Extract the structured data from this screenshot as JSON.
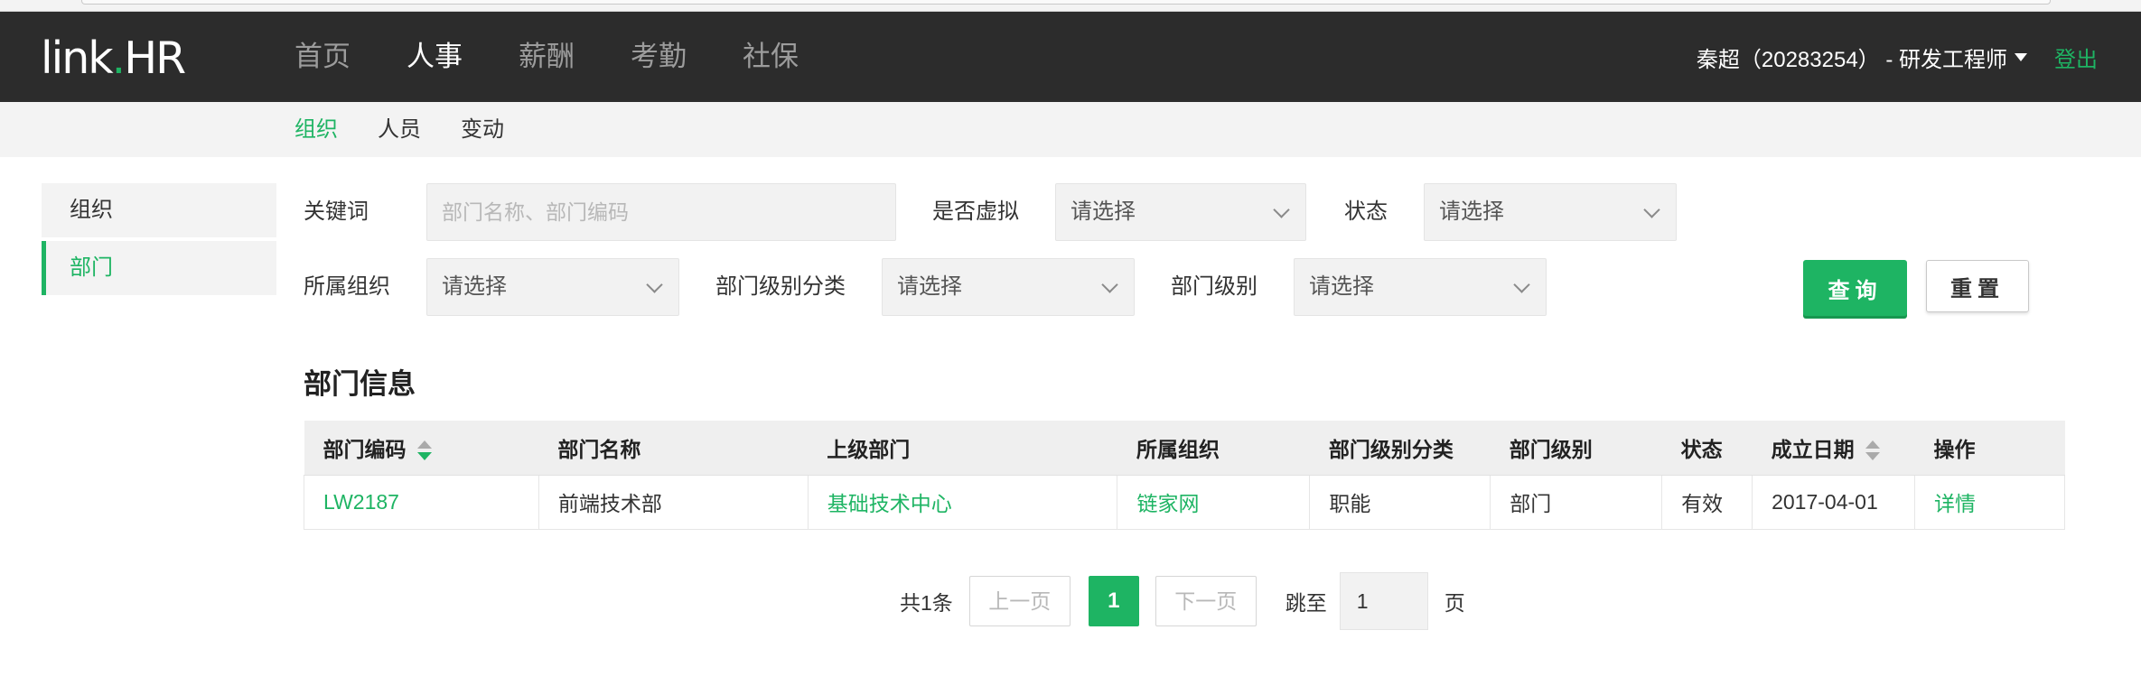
{
  "app": {
    "logo_left": "link",
    "logo_dot": ".",
    "logo_right": "HR"
  },
  "nav": {
    "items": [
      {
        "label": "首页"
      },
      {
        "label": "人事"
      },
      {
        "label": "薪酬"
      },
      {
        "label": "考勤"
      },
      {
        "label": "社保"
      }
    ],
    "active": "人事"
  },
  "user": {
    "display": "秦超（20283254） - 研发工程师",
    "logout_label": "登出"
  },
  "subnav": {
    "items": [
      {
        "label": "组织"
      },
      {
        "label": "人员"
      },
      {
        "label": "变动"
      }
    ],
    "active": "组织"
  },
  "sidebar": {
    "items": [
      {
        "label": "组织"
      },
      {
        "label": "部门"
      }
    ],
    "active": "部门"
  },
  "filters": {
    "keyword_label": "关键词",
    "keyword_placeholder": "部门名称、部门编码",
    "keyword_value": "",
    "virtual_label": "是否虚拟",
    "virtual_value": "请选择",
    "status_label": "状态",
    "status_value": "请选择",
    "org_label": "所属组织",
    "org_value": "请选择",
    "level_category_label": "部门级别分类",
    "level_category_value": "请选择",
    "level_label": "部门级别",
    "level_value": "请选择",
    "query_label": "查询",
    "reset_label": "重置"
  },
  "table": {
    "title": "部门信息",
    "columns": [
      {
        "label": "部门编码",
        "sortable": true
      },
      {
        "label": "部门名称",
        "sortable": false
      },
      {
        "label": "上级部门",
        "sortable": false
      },
      {
        "label": "所属组织",
        "sortable": false
      },
      {
        "label": "部门级别分类",
        "sortable": false
      },
      {
        "label": "部门级别",
        "sortable": false
      },
      {
        "label": "状态",
        "sortable": false
      },
      {
        "label": "成立日期",
        "sortable": true
      },
      {
        "label": "操作",
        "sortable": false
      }
    ],
    "rows": [
      {
        "code": "LW2187",
        "name": "前端技术部",
        "parent": "基础技术中心",
        "org": "链家网",
        "level_category": "职能",
        "level": "部门",
        "status": "有效",
        "established": "2017-04-01",
        "action": "详情"
      }
    ]
  },
  "pagination": {
    "total_text": "共1条",
    "prev_label": "上一页",
    "current_page": "1",
    "next_label": "下一页",
    "jump_label": "跳至",
    "jump_value": "1",
    "page_suffix": "页"
  },
  "colors": {
    "accent": "#1eb463",
    "topbar": "#2c2c2c",
    "subnav_bg": "#f3f3f3"
  }
}
